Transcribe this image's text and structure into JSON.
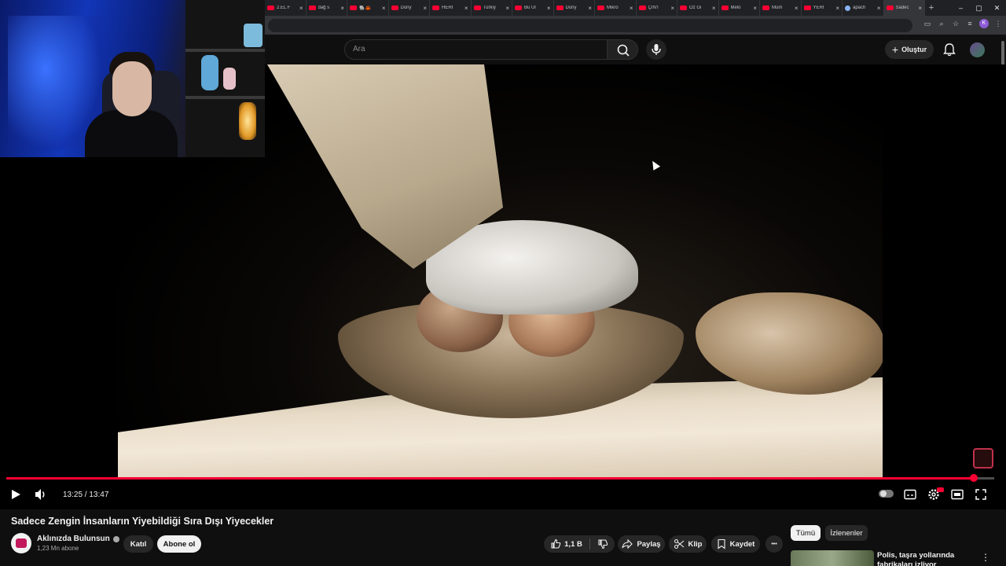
{
  "browser": {
    "tabs": [
      {
        "label": "2.EL F",
        "type": "yt"
      },
      {
        "label": "dağ s",
        "type": "yt"
      },
      {
        "label": "🐘🦀",
        "type": "yt"
      },
      {
        "label": "Düny",
        "type": "yt"
      },
      {
        "label": "HERİ",
        "type": "yt"
      },
      {
        "label": "Türkiy",
        "type": "yt"
      },
      {
        "label": "Bu Ül",
        "type": "yt"
      },
      {
        "label": "Düny",
        "type": "yt"
      },
      {
        "label": "Mikro",
        "type": "yt"
      },
      {
        "label": "ÇİN'İ",
        "type": "yt"
      },
      {
        "label": "Öz Gi",
        "type": "yt"
      },
      {
        "label": "Melo",
        "type": "yt"
      },
      {
        "label": "Mum",
        "type": "yt"
      },
      {
        "label": "YERİ",
        "type": "yt"
      },
      {
        "label": "apach",
        "type": "google"
      },
      {
        "label": "Sadec",
        "type": "yt",
        "active": true
      }
    ],
    "new_tab": "+",
    "window_controls": {
      "minimize": "–",
      "restore": "▢",
      "close": "✕"
    },
    "profile_initial": "K"
  },
  "header": {
    "search_placeholder": "Ara",
    "create_label": "Oluştur",
    "icons": {
      "search": "search-icon",
      "mic": "mic-icon",
      "bell": "bell-icon",
      "avatar": "avatar"
    }
  },
  "player": {
    "time": "13:25 / 13:47",
    "progress": 0.979,
    "accent": "#ff0033"
  },
  "video": {
    "title": "Sadece Zengin İnsanların Yiyebildiği Sıra Dışı Yiyecekler",
    "channel_name": "Aklınızda Bulunsun",
    "subscribers": "1,23 Mn abone",
    "join_label": "Katıl",
    "subscribe_label": "Abone ol",
    "likes": "1,1 B",
    "share_label": "Paylaş",
    "clip_label": "Klip",
    "save_label": "Kaydet",
    "more_label": "•••"
  },
  "sidebar": {
    "chips": [
      "Tümü",
      "İzlenenler"
    ],
    "recommendation": {
      "title": "Polis, taşra yollarında fabrikaları izliyor"
    }
  }
}
